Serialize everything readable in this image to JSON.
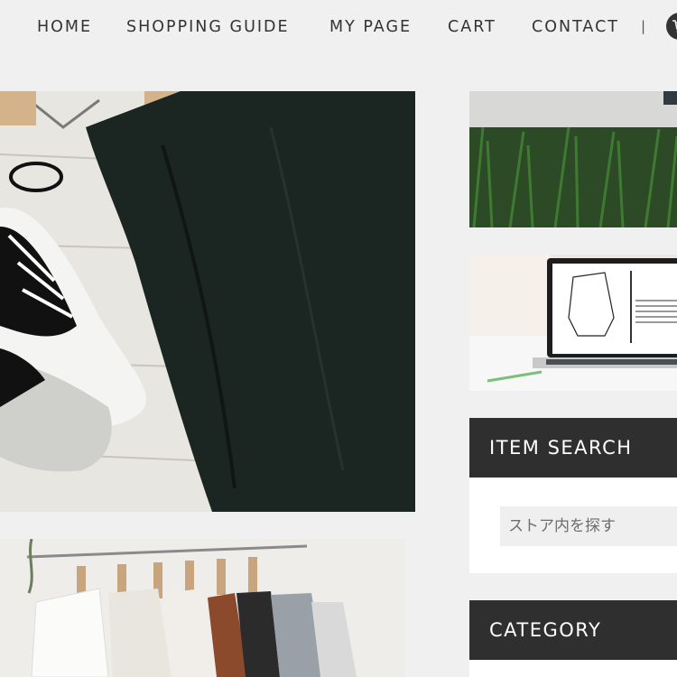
{
  "nav": {
    "items": [
      {
        "label": "HOME"
      },
      {
        "label": "SHOPPING GUIDE"
      },
      {
        "label": "MY PAGE"
      },
      {
        "label": "CART"
      },
      {
        "label": "CONTACT"
      }
    ],
    "separator": "|",
    "cart_icon": "cart-icon"
  },
  "sidebar": {
    "search": {
      "heading": "ITEM SEARCH",
      "placeholder": "ストア内を探す"
    },
    "category": {
      "heading": "CATEGORY"
    }
  },
  "colors": {
    "background": "#f0f0f0",
    "widget_header": "#2f2f2f",
    "nav_text": "#333333"
  }
}
